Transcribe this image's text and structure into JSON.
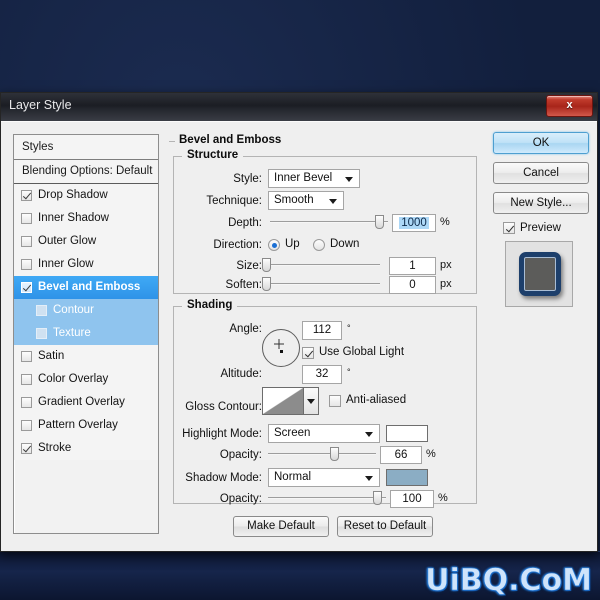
{
  "window": {
    "title": "Layer Style",
    "close_label": "x"
  },
  "sidebar": {
    "header": "Styles",
    "blending_options": "Blending Options: Default",
    "items": [
      {
        "label": "Drop Shadow",
        "checked": true,
        "selected": false,
        "child": false
      },
      {
        "label": "Inner Shadow",
        "checked": false,
        "selected": false,
        "child": false
      },
      {
        "label": "Outer Glow",
        "checked": false,
        "selected": false,
        "child": false
      },
      {
        "label": "Inner Glow",
        "checked": false,
        "selected": false,
        "child": false
      },
      {
        "label": "Bevel and Emboss",
        "checked": true,
        "selected": true,
        "child": false
      },
      {
        "label": "Contour",
        "checked": false,
        "selected": false,
        "child": true
      },
      {
        "label": "Texture",
        "checked": false,
        "selected": false,
        "child": true
      },
      {
        "label": "Satin",
        "checked": false,
        "selected": false,
        "child": false
      },
      {
        "label": "Color Overlay",
        "checked": false,
        "selected": false,
        "child": false
      },
      {
        "label": "Gradient Overlay",
        "checked": false,
        "selected": false,
        "child": false
      },
      {
        "label": "Pattern Overlay",
        "checked": false,
        "selected": false,
        "child": false
      },
      {
        "label": "Stroke",
        "checked": true,
        "selected": false,
        "child": false
      }
    ]
  },
  "main": {
    "section_title": "Bevel and Emboss",
    "structure": {
      "legend": "Structure",
      "style_label": "Style:",
      "style_value": "Inner Bevel",
      "technique_label": "Technique:",
      "technique_value": "Smooth",
      "depth_label": "Depth:",
      "depth_value": "1000",
      "depth_unit": "%",
      "direction_label": "Direction:",
      "direction_up": "Up",
      "direction_down": "Down",
      "direction_selected": "Up",
      "size_label": "Size:",
      "size_value": "1",
      "size_unit": "px",
      "soften_label": "Soften:",
      "soften_value": "0",
      "soften_unit": "px"
    },
    "shading": {
      "legend": "Shading",
      "angle_label": "Angle:",
      "angle_value": "112",
      "angle_unit": "°",
      "use_global_light": "Use Global Light",
      "use_global_light_checked": true,
      "altitude_label": "Altitude:",
      "altitude_value": "32",
      "altitude_unit": "°",
      "gloss_contour_label": "Gloss Contour:",
      "anti_aliased": "Anti-aliased",
      "anti_aliased_checked": false,
      "highlight_mode_label": "Highlight Mode:",
      "highlight_mode_value": "Screen",
      "highlight_color": "#ffffff",
      "highlight_opacity_label": "Opacity:",
      "highlight_opacity_value": "66",
      "highlight_opacity_unit": "%",
      "shadow_mode_label": "Shadow Mode:",
      "shadow_mode_value": "Normal",
      "shadow_color": "#8badc4",
      "shadow_opacity_label": "Opacity:",
      "shadow_opacity_value": "100",
      "shadow_opacity_unit": "%"
    },
    "make_default": "Make Default",
    "reset_to_default": "Reset to Default"
  },
  "right": {
    "ok": "OK",
    "cancel": "Cancel",
    "new_style": "New Style...",
    "preview": "Preview",
    "preview_checked": true
  },
  "watermark": "UiBQ.CoM"
}
